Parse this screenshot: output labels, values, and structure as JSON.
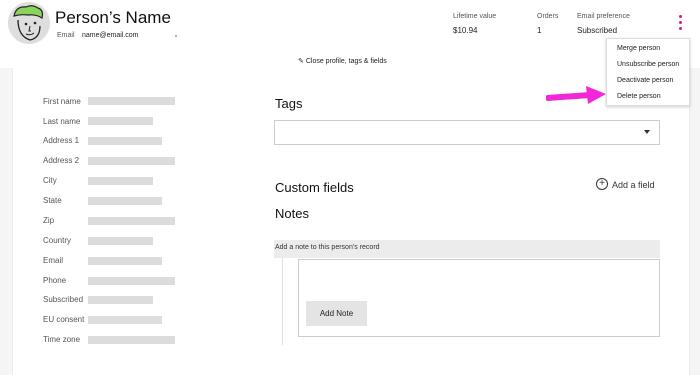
{
  "header": {
    "person_name": "Person’s Name",
    "email_label": "Email",
    "email_value": "name@email.com",
    "stats": [
      {
        "label": "Lifetime value",
        "value": "$10.94"
      },
      {
        "label": "Orders",
        "value": "1"
      },
      {
        "label": "Email preference",
        "value": "Subscribed"
      }
    ],
    "menu_icon": "kebab-menu-icon",
    "accent_color": "#d31d8c"
  },
  "close_link": "Close profile, tags & fields",
  "dropdown": {
    "items": [
      "Merge person",
      "Unsubscribe person",
      "Deactivate person",
      "Delete person"
    ]
  },
  "profile_fields": [
    "First name",
    "Last name",
    "Address 1",
    "Address 2",
    "City",
    "State",
    "Zip",
    "Country",
    "Email",
    "Phone",
    "Subscribed",
    "EU consent",
    "Time zone"
  ],
  "tags": {
    "title": "Tags"
  },
  "custom_fields": {
    "title": "Custom fields",
    "add_label": "Add a field"
  },
  "notes": {
    "title": "Notes",
    "header": "Add a note to this person’s record",
    "button": "Add Note"
  },
  "annotation": {
    "arrow_color": "#f227d8"
  }
}
